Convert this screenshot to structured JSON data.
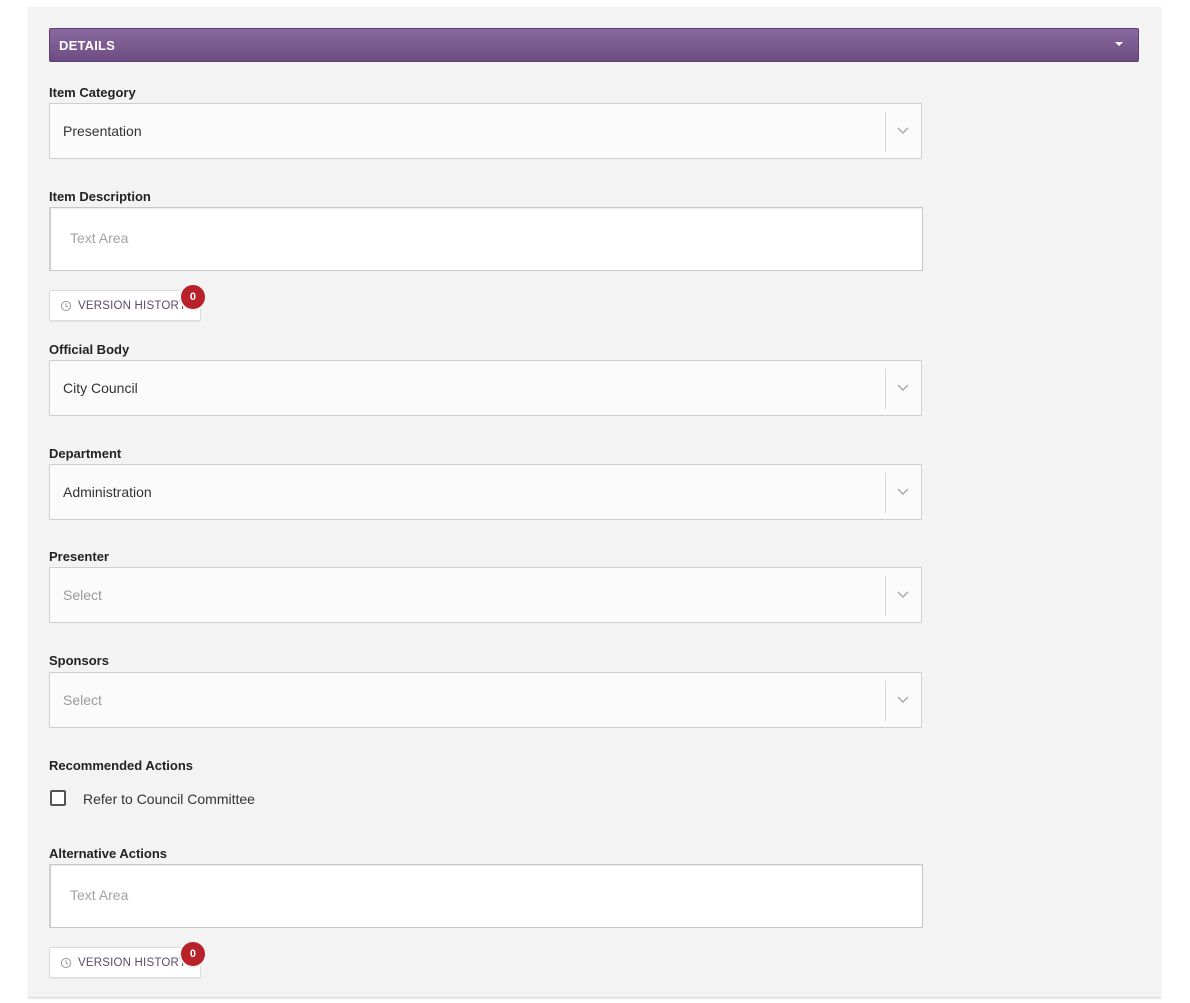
{
  "section": {
    "title": "DETAILS"
  },
  "fields": {
    "item_category": {
      "label": "Item Category",
      "value": "Presentation"
    },
    "item_description": {
      "label": "Item Description",
      "placeholder": "Text Area",
      "version_history_label": "VERSION HISTORY",
      "version_count": "0"
    },
    "official_body": {
      "label": "Official Body",
      "value": "City Council"
    },
    "department": {
      "label": "Department",
      "value": "Administration"
    },
    "presenter": {
      "label": "Presenter",
      "placeholder": "Select"
    },
    "sponsors": {
      "label": "Sponsors",
      "placeholder": "Select"
    },
    "recommended_actions": {
      "label": "Recommended Actions",
      "checkbox_label": "Refer to Council Committee",
      "checked": false
    },
    "alternative_actions": {
      "label": "Alternative Actions",
      "placeholder": "Text Area",
      "version_history_label": "VERSION HISTORY",
      "version_count": "0"
    }
  },
  "icons": {
    "section_toggle": "caret-down-icon",
    "dropdown": "chevron-down-icon",
    "history": "history-icon"
  },
  "colors": {
    "header_purple": "#7a5a8f",
    "badge_red": "#b8202a",
    "panel_bg": "#f3f3f3"
  }
}
